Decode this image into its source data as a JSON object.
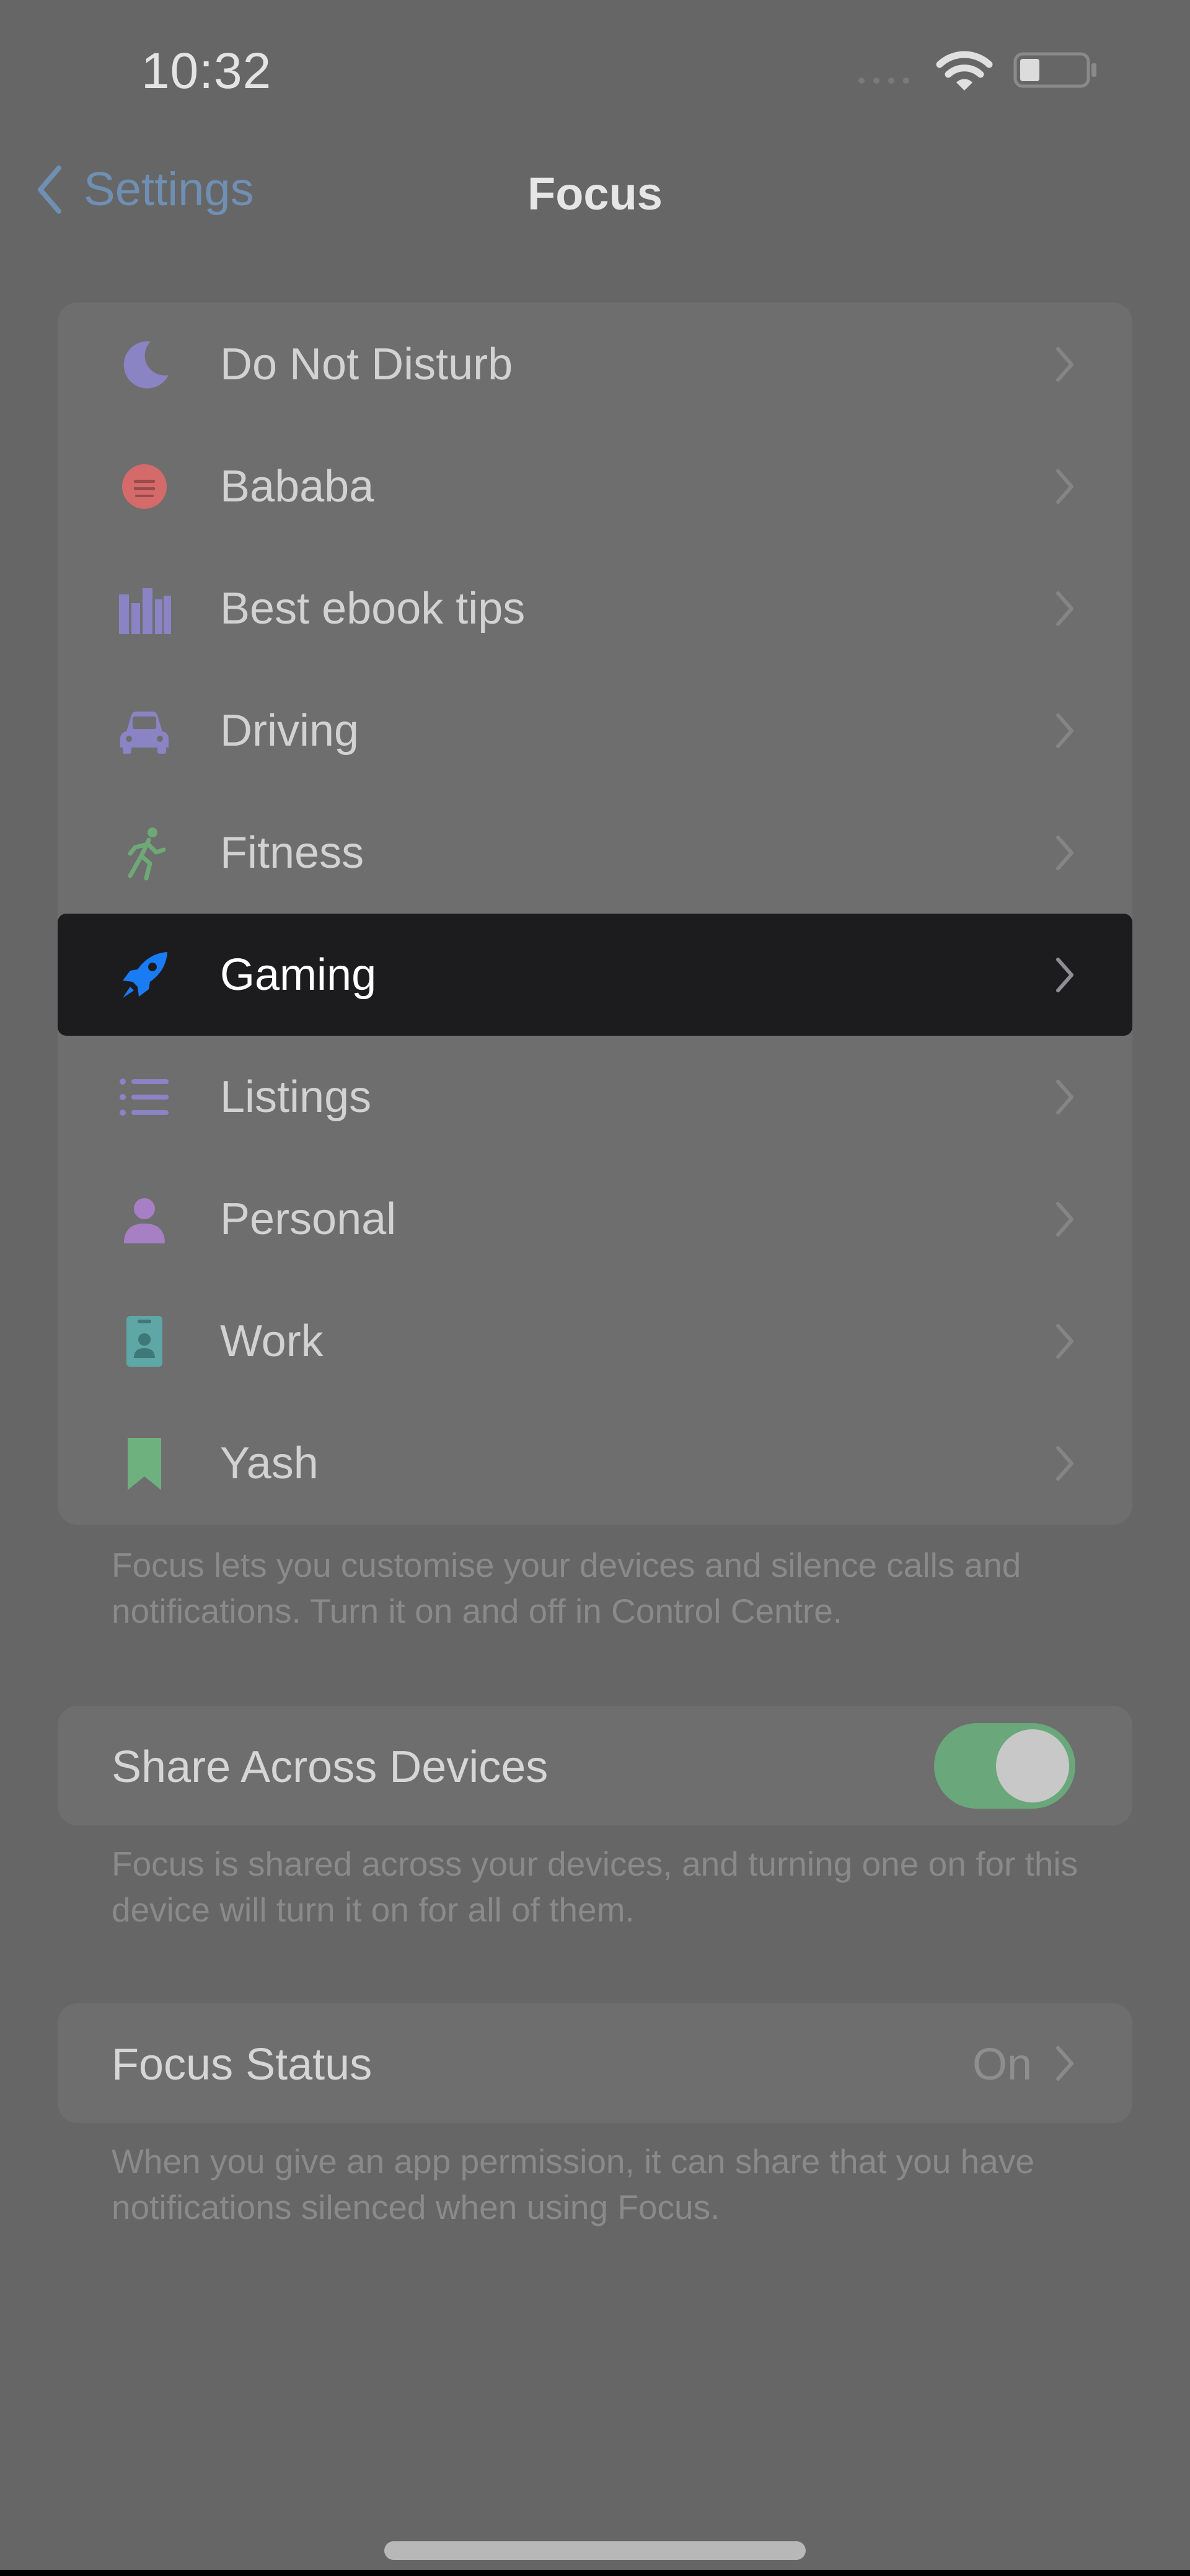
{
  "status_bar": {
    "time": "10:32",
    "icons": [
      "cellular-signal-icon",
      "wifi-icon",
      "battery-icon"
    ],
    "battery_level": 0.3
  },
  "nav": {
    "back_label": "Settings",
    "title": "Focus"
  },
  "focus_modes": [
    {
      "label": "Do Not Disturb",
      "icon": "moon-icon",
      "color": "#8a83c4",
      "selected": false
    },
    {
      "label": "Bababa",
      "icon": "smiley-face-icon",
      "color": "#d46a6a",
      "selected": false
    },
    {
      "label": "Best ebook tips",
      "icon": "books-icon",
      "color": "#8a83c4",
      "selected": false
    },
    {
      "label": "Driving",
      "icon": "car-icon",
      "color": "#8a83c4",
      "selected": false
    },
    {
      "label": "Fitness",
      "icon": "running-person-icon",
      "color": "#6fa877",
      "selected": false
    },
    {
      "label": "Gaming",
      "icon": "rocket-icon",
      "color": "#1a7cf5",
      "selected": true
    },
    {
      "label": "Listings",
      "icon": "list-icon",
      "color": "#8a83c4",
      "selected": false
    },
    {
      "label": "Personal",
      "icon": "person-icon",
      "color": "#a77fc4",
      "selected": false
    },
    {
      "label": "Work",
      "icon": "id-badge-icon",
      "color": "#5fa6a6",
      "selected": false
    },
    {
      "label": "Yash",
      "icon": "bookmark-icon",
      "color": "#6fb07f",
      "selected": false
    }
  ],
  "focus_footer": "Focus lets you customise your devices and silence calls and notifications. Turn it on and off in Control Centre.",
  "share_across_devices": {
    "label": "Share Across Devices",
    "enabled": true,
    "toggle_color": "#6aa87b",
    "footer": "Focus is shared across your devices, and turning one on for this device will turn it on for all of them."
  },
  "focus_status": {
    "label": "Focus Status",
    "value": "On",
    "footer": "When you give an app permission, it can share that you have notifications silenced when using Focus."
  },
  "colors": {
    "background": "#666666",
    "card": "#6e6e6e",
    "selected_row": "#1c1c1e",
    "accent_link": "#6f8fb3"
  }
}
